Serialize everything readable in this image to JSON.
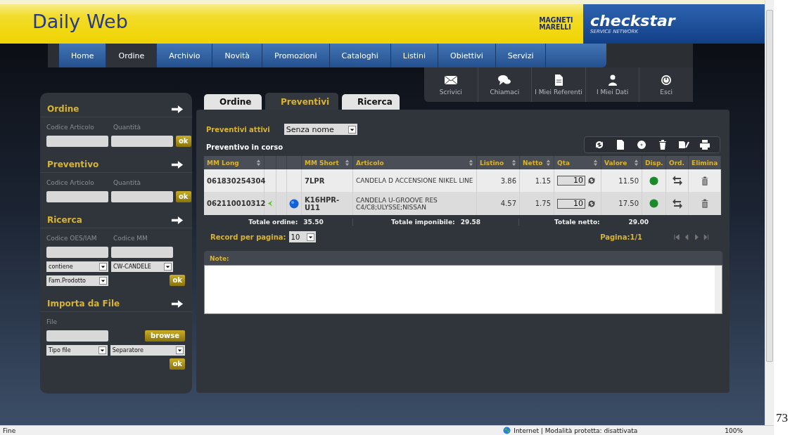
{
  "header": {
    "title": "Daily Web",
    "brand_logo": [
      "MAGNETI",
      "MARELLI"
    ],
    "partner_logo": {
      "name": "checkstar",
      "tagline": "SERVICE NETWORK"
    }
  },
  "nav": [
    {
      "label": "Home",
      "selected": false
    },
    {
      "label": "Ordine",
      "selected": true
    },
    {
      "label": "Archivio",
      "selected": false
    },
    {
      "label": "Novità",
      "selected": false
    },
    {
      "label": "Promozioni",
      "selected": false
    },
    {
      "label": "Cataloghi",
      "selected": false
    },
    {
      "label": "Listini",
      "selected": false
    },
    {
      "label": "Obiettivi",
      "selected": false
    },
    {
      "label": "Servizi",
      "selected": false
    }
  ],
  "quick_links": [
    "Scrivici",
    "Chiamaci",
    "I Miei Referenti",
    "I Miei Dati",
    "Esci"
  ],
  "sidebar": [
    {
      "kind": "entry",
      "title": "Ordine",
      "labels": [
        "Codice Articolo",
        "Quantità"
      ],
      "button": "ok"
    },
    {
      "kind": "entry",
      "title": "Preventivo",
      "labels": [
        "Codice Articolo",
        "Quantità"
      ],
      "button": "ok"
    },
    {
      "kind": "search",
      "title": "Ricerca",
      "labels": [
        "Codice OES/IAM",
        "Codice MM"
      ],
      "selects": [
        "contiene",
        "CW-CANDELE",
        "Fam.Prodotto"
      ],
      "button": "ok"
    },
    {
      "kind": "import",
      "title": "Importa da File",
      "labels": [
        "File"
      ],
      "browse": "browse",
      "selects": [
        "Tipo file",
        "Separatore"
      ],
      "button": "ok"
    }
  ],
  "tabs": [
    {
      "label": "Ordine",
      "selected": false
    },
    {
      "label": "Preventivi",
      "selected": true
    },
    {
      "label": "Ricerca",
      "selected": false
    }
  ],
  "active_quotes": {
    "label": "Preventivi attivi",
    "value": "Senza nome"
  },
  "current_title": "Preventivo in corso",
  "table": {
    "columns": [
      {
        "label": "MM Long",
        "sortable": true
      },
      {
        "sortable": false
      },
      {
        "sortable": false
      },
      {
        "sortable": false
      },
      {
        "label": "MM Short",
        "sortable": true
      },
      {
        "label": "Articolo",
        "sortable": true
      },
      {
        "label": "Listino",
        "sortable": true
      },
      {
        "label": "Netto",
        "sortable": true
      },
      {
        "label": "Qta",
        "sortable": true
      },
      {
        "label": "Valore",
        "sortable": true
      },
      {
        "label": "Disp.",
        "sortable": false
      },
      {
        "label": "Ord.",
        "sortable": false
      },
      {
        "label": "Elimina",
        "sortable": false
      }
    ],
    "rows": [
      {
        "mm_long": "061830254304",
        "arrow_mark": false,
        "info_dot": false,
        "mm_short": "7LPR",
        "articolo": "CANDELA D ACCENSIONE NIKEL LINE",
        "listino": "3.86",
        "netto": "1.15",
        "qta": "10",
        "valore": "11.50",
        "available": true
      },
      {
        "mm_long": "062110010312",
        "arrow_mark": true,
        "info_dot": true,
        "mm_short": "K16HPR-U11",
        "articolo": "CANDELA U-GROOVE RES C4/C8;ULYSSE;NISSAN",
        "listino": "4.57",
        "netto": "1.75",
        "qta": "10",
        "valore": "17.50",
        "available": true
      }
    ],
    "totals": [
      {
        "label": "Totale ordine:",
        "value": "35.50"
      },
      {
        "label": "Totale imponibile:",
        "value": "29.58"
      },
      {
        "label": "Totale netto:",
        "value": "29.00"
      }
    ],
    "records_per_page": {
      "label": "Record per pagina:",
      "value": "10"
    },
    "page": "Pagina:1/1"
  },
  "note": {
    "label": "Note:"
  },
  "status_bar": {
    "text": "Fine",
    "zone": "Internet | Modalità protetta: disattivata",
    "zoom": "100%"
  },
  "page_mark": "73"
}
